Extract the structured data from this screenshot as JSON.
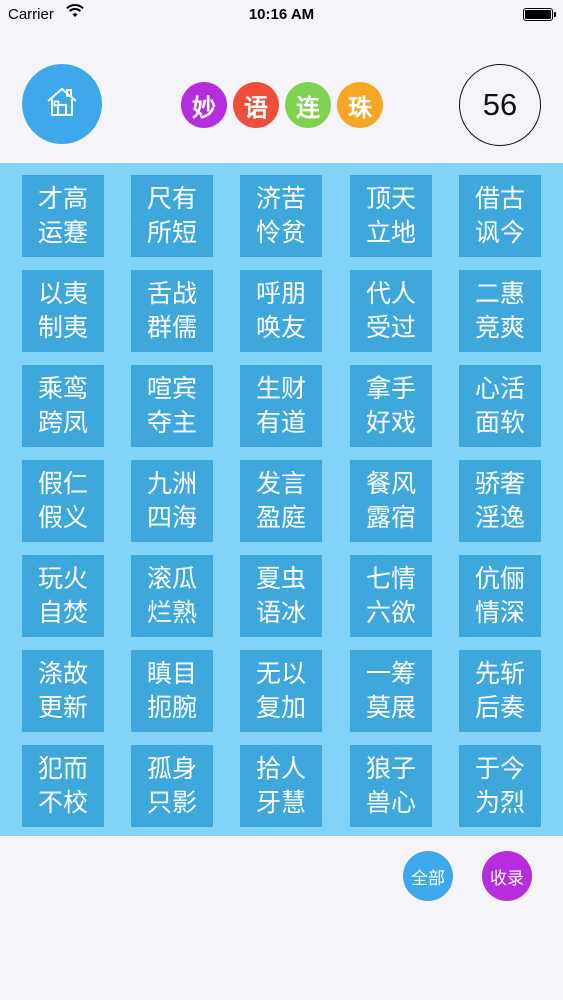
{
  "status_bar": {
    "carrier": "Carrier",
    "time": "10:16 AM",
    "icons": [
      "wifi-icon",
      "battery-icon"
    ]
  },
  "header": {
    "home_icon": "house-icon",
    "title_chars": [
      {
        "char": "妙",
        "color": "#b62ddd"
      },
      {
        "char": "语",
        "color": "#ef4f3a"
      },
      {
        "char": "连",
        "color": "#7fd150"
      },
      {
        "char": "珠",
        "color": "#f6a524"
      }
    ],
    "counter": "56"
  },
  "board": {
    "tile_color": "#3ea8dc",
    "background_color": "#82d3f8",
    "tiles": [
      {
        "line1": "才高",
        "line2": "运蹇"
      },
      {
        "line1": "尺有",
        "line2": "所短"
      },
      {
        "line1": "济苦",
        "line2": "怜贫"
      },
      {
        "line1": "顶天",
        "line2": "立地"
      },
      {
        "line1": "借古",
        "line2": "讽今"
      },
      {
        "line1": "以夷",
        "line2": "制夷"
      },
      {
        "line1": "舌战",
        "line2": "群儒"
      },
      {
        "line1": "呼朋",
        "line2": "唤友"
      },
      {
        "line1": "代人",
        "line2": "受过"
      },
      {
        "line1": "二惠",
        "line2": "竞爽"
      },
      {
        "line1": "乘鸾",
        "line2": "跨凤"
      },
      {
        "line1": "喧宾",
        "line2": "夺主"
      },
      {
        "line1": "生财",
        "line2": "有道"
      },
      {
        "line1": "拿手",
        "line2": "好戏"
      },
      {
        "line1": "心活",
        "line2": "面软"
      },
      {
        "line1": "假仁",
        "line2": "假义"
      },
      {
        "line1": "九洲",
        "line2": "四海"
      },
      {
        "line1": "发言",
        "line2": "盈庭"
      },
      {
        "line1": "餐风",
        "line2": "露宿"
      },
      {
        "line1": "骄奢",
        "line2": "淫逸"
      },
      {
        "line1": "玩火",
        "line2": "自焚"
      },
      {
        "line1": "滚瓜",
        "line2": "烂熟"
      },
      {
        "line1": "夏虫",
        "line2": "语冰"
      },
      {
        "line1": "七情",
        "line2": "六欲"
      },
      {
        "line1": "伉俪",
        "line2": "情深"
      },
      {
        "line1": "涤故",
        "line2": "更新"
      },
      {
        "line1": "瞋目",
        "line2": "扼腕"
      },
      {
        "line1": "无以",
        "line2": "复加"
      },
      {
        "line1": "一筹",
        "line2": "莫展"
      },
      {
        "line1": "先斩",
        "line2": "后奏"
      },
      {
        "line1": "犯而",
        "line2": "不校"
      },
      {
        "line1": "孤身",
        "line2": "只影"
      },
      {
        "line1": "拾人",
        "line2": "牙慧"
      },
      {
        "line1": "狼子",
        "line2": "兽心"
      },
      {
        "line1": "于今",
        "line2": "为烈"
      }
    ]
  },
  "footer": {
    "all_label": "全部",
    "collect_label": "收录"
  }
}
